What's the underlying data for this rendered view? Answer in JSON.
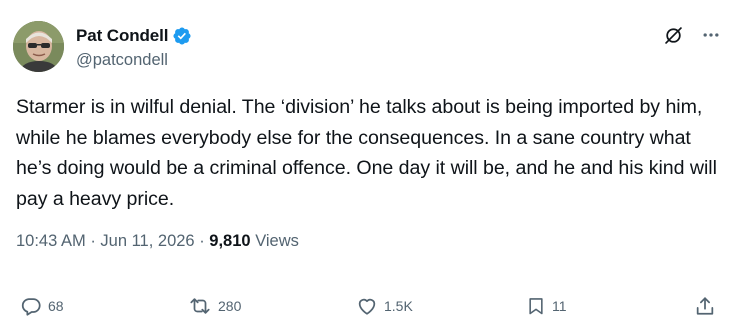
{
  "tweet": {
    "author": {
      "display_name": "Pat Condell",
      "handle": "@patcondell",
      "verified": true
    },
    "text": "Starmer is in wilful denial. The ‘division’ he talks about is being imported by him, while he blames everybody else for the consequences. In a sane country what he’s doing would be a criminal offence. One day it will be, and he and his kind will pay a heavy price.",
    "time": "10:43 AM",
    "separator": "·",
    "date": "Jun 11, 2026",
    "views_count": "9,810",
    "views_label": "Views"
  },
  "actions": {
    "replies": "68",
    "retweets": "280",
    "likes": "1.5K",
    "bookmarks": "11"
  },
  "icons": {
    "header": [
      "grok-icon",
      "more-icon"
    ],
    "footer": [
      "reply-icon",
      "retweet-icon",
      "like-icon",
      "bookmark-icon",
      "share-icon"
    ]
  },
  "colors": {
    "text_primary": "#0f1419",
    "text_secondary": "#536471",
    "verified_blue": "#1d9bf0"
  }
}
